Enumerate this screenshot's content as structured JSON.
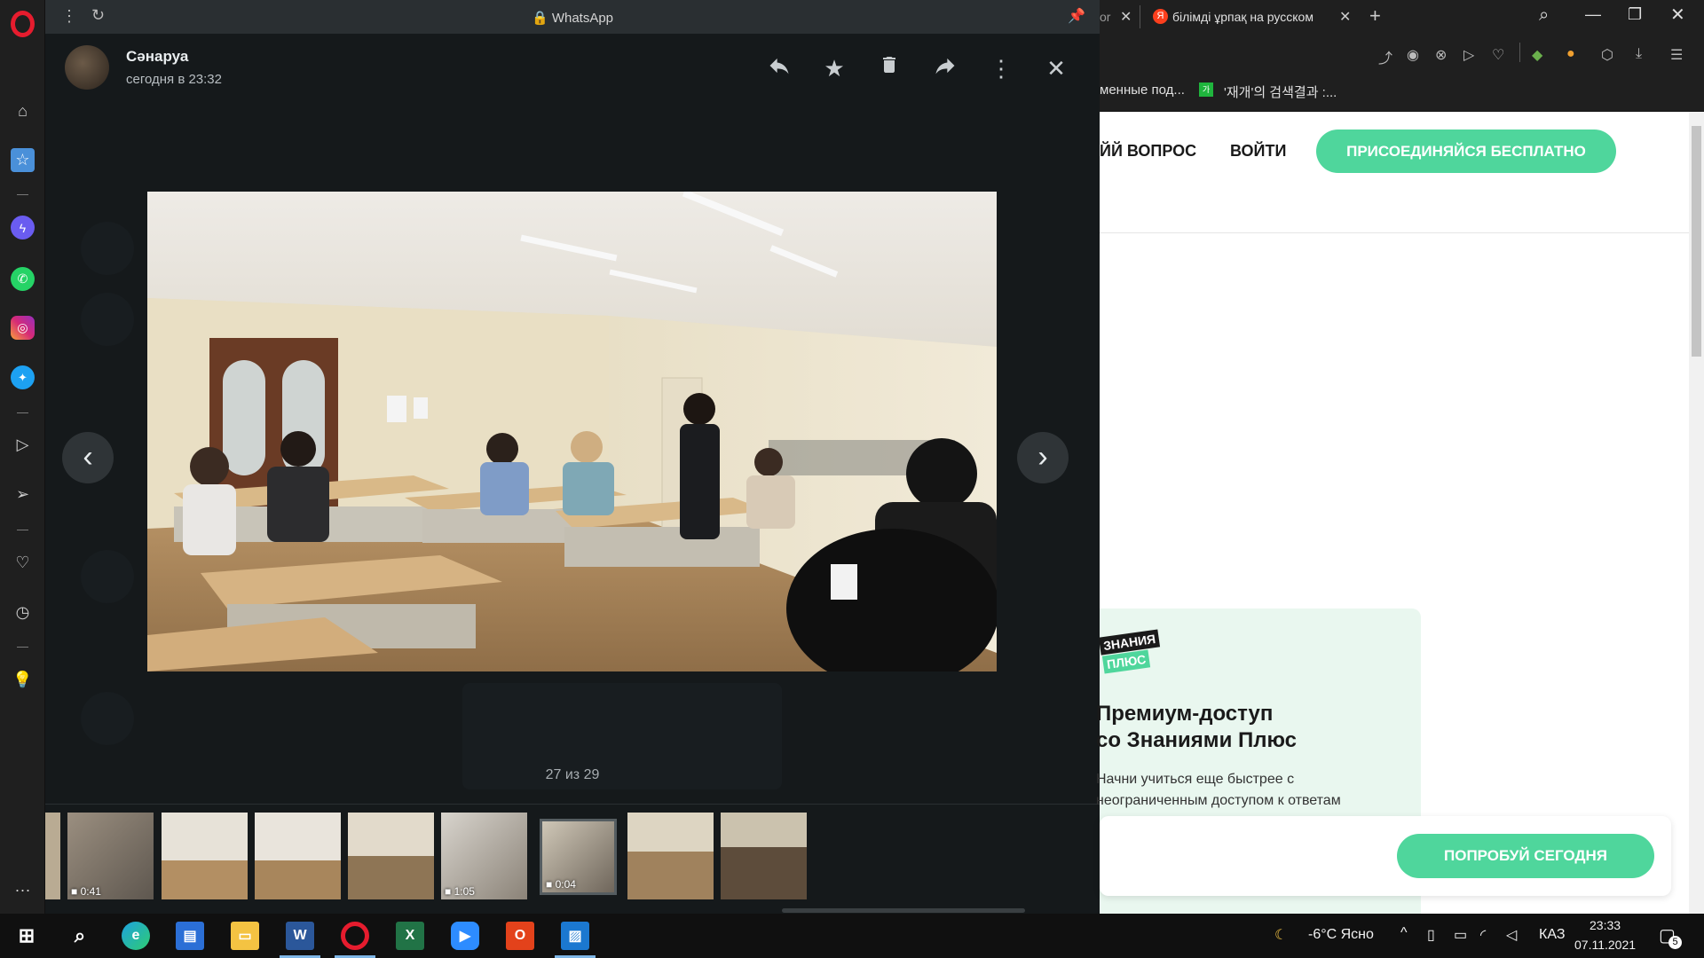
{
  "whatsapp": {
    "window_title": "WhatsApp",
    "sender_name": "Сәнаруа",
    "sender_time": "сегодня в 23:32",
    "counter": "27 из 29",
    "thumbnails": [
      {
        "duration": ""
      },
      {
        "duration": "0:41"
      },
      {
        "duration": ""
      },
      {
        "duration": ""
      },
      {
        "duration": ""
      },
      {
        "duration": "1:05"
      },
      {
        "duration": "0:04"
      },
      {
        "duration": ""
      },
      {
        "duration": ""
      }
    ],
    "icons": [
      "reply-icon",
      "star-icon",
      "delete-icon",
      "forward-icon",
      "more-icon",
      "close-icon"
    ]
  },
  "browser": {
    "tab_prev_fragment": "or",
    "tab_active_label": "білімді ұрпақ на русском",
    "bookmark_1": "менные под...",
    "bookmark_2": "'재개'의 검색결과 :...",
    "nav_question": "ЙЙ ВОПРОС",
    "nav_login": "ВОЙТИ",
    "join_button": "ПРИСОЕДИНЯЙСЯ БЕСПЛАТНО",
    "promo_logo_line1": "ЗНАНИЯ",
    "promo_logo_line2": "ПЛЮС",
    "promo_title_line1": "Премиум-доступ",
    "promo_title_line2": "со Знаниями Плюс",
    "promo_text_line1": "Начни учиться еще быстрее с",
    "promo_text_line2": "неограниченным доступом к ответам",
    "try_button": "ПОПРОБУЙ СЕГОДНЯ",
    "accent_color": "#4fd69c"
  },
  "taskbar": {
    "weather": "-6°C  Ясно",
    "language": "КАЗ",
    "time": "23:33",
    "date": "07.11.2021",
    "notification_count": "5"
  }
}
